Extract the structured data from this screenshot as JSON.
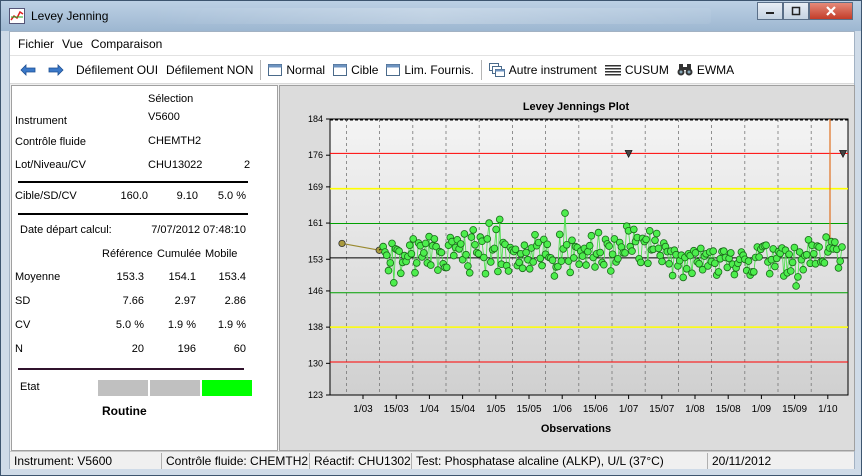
{
  "window": {
    "title": "Levey Jenning"
  },
  "menu": [
    "Fichier",
    "Vue",
    "Comparaison"
  ],
  "toolbar": {
    "back_icon": "arrow-left-icon",
    "forward_icon": "arrow-right-icon",
    "scroll_on": "Défilement OUI",
    "scroll_off": "Défilement NON",
    "normal": "Normal",
    "cible": "Cible",
    "lim": "Lim. Fournis.",
    "autre": "Autre instrument",
    "cusum": "CUSUM",
    "ewma": "EWMA"
  },
  "left": {
    "selection_header": "Sélection",
    "instrument_label": "Instrument",
    "instrument_value": "V5600",
    "fluid_label": "Contrôle fluide",
    "fluid_value": "CHEMTH2",
    "lot_label": "Lot/Niveau/CV",
    "lot_value": "CHU13022",
    "lot_level": "2",
    "target_label": "Cible/SD/CV",
    "target_mean": "160.0",
    "target_sd": "9.10",
    "target_cv": "5.0 %",
    "date_label": "Date départ calcul:",
    "date_value": "7/07/2012 07:48:10",
    "col_ref": "Référence",
    "col_cum": "Cumulée",
    "col_mob": "Mobile",
    "rows": [
      {
        "label": "Moyenne",
        "ref": "153.3",
        "cum": "154.1",
        "mob": "153.4"
      },
      {
        "label": "SD",
        "ref": "7.66",
        "cum": "2.97",
        "mob": "2.86"
      },
      {
        "label": "CV",
        "ref": "5.0 %",
        "cum": "1.9 %",
        "mob": "1.9 %"
      },
      {
        "label": "N",
        "ref": "20",
        "cum": "196",
        "mob": "60"
      }
    ],
    "state_label": "Etat",
    "state_text": "Routine",
    "state_colors": [
      "#c0c0c0",
      "#c0c0c0",
      "#00ff00"
    ]
  },
  "status": {
    "instrument": "Instrument: V5600",
    "fluid": "Contrôle fluide: CHEMTH2",
    "reagent": "Réactif: CHU13022",
    "test": "Test: Phosphatase alcaline (ALKP), U/L (37°C)",
    "date": "20/11/2012"
  },
  "chart_data": {
    "type": "scatter",
    "title": "Levey Jennings Plot",
    "xlabel": "Observations",
    "ylabel": "",
    "y_ticks": [
      184,
      176,
      169,
      161,
      153,
      146,
      138,
      130,
      123
    ],
    "ylim": [
      123,
      184
    ],
    "x_ticks": [
      "1/03",
      "15/03",
      "1/04",
      "15/04",
      "1/05",
      "15/05",
      "1/06",
      "15/06",
      "1/07",
      "15/07",
      "1/08",
      "15/08",
      "1/09",
      "15/09",
      "1/10"
    ],
    "reference_lines": [
      {
        "value": 176.4,
        "color": "#ff0000"
      },
      {
        "value": 168.6,
        "color": "#ffff00"
      },
      {
        "value": 160.9,
        "color": "#00a000"
      },
      {
        "value": 153.3,
        "color": "#000000"
      },
      {
        "value": 145.6,
        "color": "#00a000"
      },
      {
        "value": 138.0,
        "color": "#ffff00"
      },
      {
        "value": 130.3,
        "color": "#ff0000"
      }
    ],
    "reference_points": [
      {
        "x": "start",
        "y": 156.5
      },
      {
        "x": "15/03",
        "y": 155.0
      }
    ],
    "markers": [
      {
        "x": "1/07",
        "y": 176.4
      },
      {
        "x": "end",
        "y": 176.4
      }
    ],
    "series": [
      {
        "values": [
          155.8,
          154.6,
          153.9,
          150.5,
          152.2,
          156.5,
          147.8,
          155.3,
          155.1,
          154.8,
          149.9,
          152.3,
          153.8,
          152.5,
          153.6,
          156.1,
          154.2,
          157.5,
          150.0,
          152.2,
          156.6,
          156.0,
          153.5,
          154.4,
          156.5,
          152.2,
          158.0,
          151.7,
          156.0,
          157.5,
          155.8,
          150.6,
          154.7,
          154.5,
          152.0,
          151.2,
          151.2,
          156.1,
          157.8,
          156.9,
          153.8,
          155.6,
          157.3,
          155.3,
          156.4,
          152.9,
          158.6,
          154.0,
          151.5,
          150.0,
          157.9,
          159.5,
          156.2,
          154.5,
          154.2,
          157.9,
          157.0,
          153.4,
          149.8,
          157.5,
          161.0,
          152.4,
          155.1,
          155.4,
          159.6,
          150.3,
          161.8,
          151.9,
          156.7,
          156.3,
          151.6,
          150.4,
          155.6,
          155.0,
          154.7,
          155.2,
          151.6,
          152.3,
          154.2,
          151.0,
          156.1,
          154.5,
          152.9,
          150.9,
          155.5,
          152.4,
          158.4,
          156.0,
          156.7,
          153.2,
          151.6,
          157.4,
          154.1,
          156.3,
          153.4,
          153.3,
          152.8,
          149.3,
          151.3,
          151.4,
          158.5,
          152.6,
          155.3,
          163.2,
          156.2,
          152.6,
          150.1,
          157.2,
          153.3,
          155.8,
          155.6,
          151.9,
          154.8,
          153.7,
          155.4,
          151.7,
          154.7,
          156.0,
          158.2,
          153.4,
          151.3,
          154.2,
          158.9,
          154.5,
          152.3,
          151.8,
          157.4,
          156.4,
          155.9,
          150.4,
          154.1,
          157.5,
          152.4,
          153.1,
          156.7,
          155.7,
          154.4,
          154.4,
          160.3,
          159.3,
          155.8,
          154.8,
          159.6,
          156.9,
          157.8,
          153.1,
          152.3,
          157.6,
          156.9,
          157.4,
          152.1,
          159.3,
          155.1,
          155.2,
          157.2,
          158.7,
          155.4,
          153.8,
          152.5,
          156.6,
          155.8,
          154.7,
          152.0,
          154.8,
          149.4,
          155.0,
          154.0,
          151.5,
          152.7,
          153.9,
          149.0,
          153.4,
          150.9,
          154.2,
          153.8,
          149.9,
          154.9,
          154.4,
          152.4,
          152.0,
          155.4,
          150.7,
          153.7,
          154.2,
          151.5,
          154.6,
          152.5,
          154.8,
          152.1,
          149.5,
          150.2,
          153.1,
          154.7,
          154.8,
          153.4,
          151.2,
          153.2,
          154.4,
          151.9,
          149.6,
          151.1,
          152.1,
          153.0,
          154.6,
          153.9,
          153.0,
          150.5,
          152.6,
          149.5,
          150.2,
          150.2,
          153.4,
          155.7,
          153.5,
          155.2,
          155.8,
          156.0,
          156.1,
          152.4,
          149.8,
          152.9,
          155.3,
          151.4,
          153.2,
          154.7,
          154.3,
          155.5,
          149.3,
          155.0,
          150.0,
          154.1,
          150.4,
          152.3,
          155.6,
          147.1,
          149.1,
          154.6,
          152.9,
          150.7,
          153.8,
          154.0,
          157.3,
          152.1,
          156.1,
          154.2,
          152.0,
          155.9,
          155.7,
          152.4,
          152.5,
          152.2,
          157.9,
          154.6,
          155.5,
          156.9,
          155.3,
          156.8,
          155.2,
          151.1,
          152.6,
          155.7
        ]
      }
    ]
  }
}
